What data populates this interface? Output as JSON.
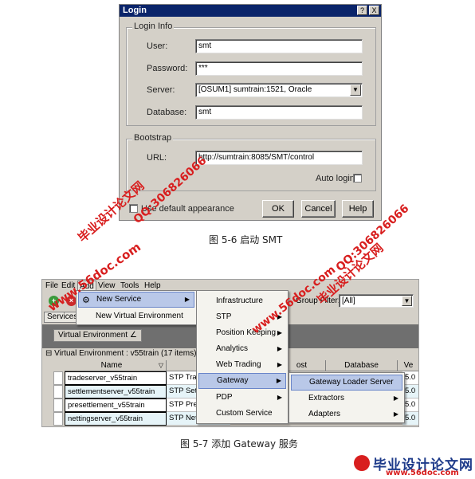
{
  "login": {
    "title": "Login",
    "close_label": "X",
    "help_corner": "?",
    "login_info_label": "Login Info",
    "user_label": "User:",
    "user_value": "smt",
    "password_label": "Password:",
    "password_value": "***",
    "server_label": "Server:",
    "server_value": "[OSUM1] sumtrain:1521, Oracle",
    "database_label": "Database:",
    "database_value": "smt",
    "bootstrap_label": "Bootstrap",
    "url_label": "URL:",
    "url_value": "http://sumtrain:8085/SMT/control",
    "auto_login_label": "Auto login",
    "default_appearance_label": "Use default appearance",
    "ok_label": "OK",
    "cancel_label": "Cancel",
    "help_label": "Help"
  },
  "caption1": "图 5-6   启动 SMT",
  "caption2": "图 5-7   添加 Gateway 服务",
  "app": {
    "menu": [
      "File",
      "Edit",
      "Add",
      "View",
      "Tools",
      "Help"
    ],
    "services_tab": "Services",
    "group_filter_label": "Group Filter:",
    "group_filter_value": "[All]",
    "ve_button": "Virtual Environment",
    "group_row": "Virtual Environment : v55train (17 items)",
    "columns": [
      "Name",
      "ost",
      "Database",
      "Ve"
    ],
    "rows": [
      {
        "name": "tradeserver_v55train",
        "type": "STP Trad",
        "ver": "5.0"
      },
      {
        "name": "settlementserver_v55train",
        "type": "STP Sett",
        "ver": "5.0"
      },
      {
        "name": "presettlement_v55train",
        "type": "STP PreS",
        "ver": "5.0"
      },
      {
        "name": "nettingserver_v55train",
        "type": "STP Nett",
        "ver": "5.0"
      }
    ],
    "add_menu": [
      "New Service",
      "New Virtual Environment"
    ],
    "service_menu": [
      "Infrastructure",
      "STP",
      "Position Keeping",
      "Analytics",
      "Web Trading",
      "Gateway",
      "PDP",
      "Custom Service"
    ],
    "gateway_menu": [
      "Gateway Loader Server",
      "Extractors",
      "Adapters"
    ]
  },
  "watermarks": {
    "site": "www.56doc.com",
    "qq": "QQ:306826066",
    "brand": "毕业设计论文网"
  },
  "logo": {
    "brand": "毕业设计论文网",
    "url": "www.56doc.com"
  },
  "colors": {
    "titlebar": "#0a246a",
    "menu_highlight": "#b9c8e8",
    "watermark": "#d81e1e"
  }
}
